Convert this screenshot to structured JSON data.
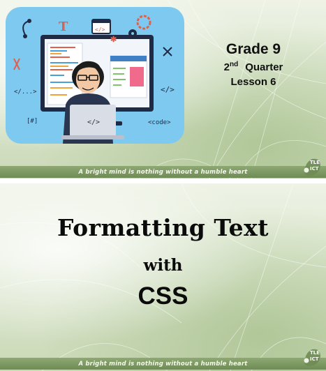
{
  "slide1": {
    "grade": "Grade 9",
    "quarter_number": "2",
    "quarter_suffix": "nd",
    "quarter_word": "Quarter",
    "lesson": "Lesson 6",
    "footer": "A bright mind is nothing without a humble heart",
    "logo_line1": "TLE",
    "logo_line2": "ICT",
    "illustration": {
      "tags": {
        "left_code": "</...>",
        "right_code": "</>",
        "bottom_code": "<code>",
        "hash": "[#]",
        "monitor_code": "</>",
        "type_letter": "T",
        "window_code": "</>"
      }
    }
  },
  "slide2": {
    "title": "Formatting Text",
    "with": "with",
    "css": "CSS",
    "footer": "A bright mind is nothing without a humble heart",
    "logo_line1": "TLE",
    "logo_line2": "ICT"
  },
  "colors": {
    "illustration_bg": "#7ec9ef",
    "footer_band": "#7a9660",
    "text": "#111111"
  }
}
